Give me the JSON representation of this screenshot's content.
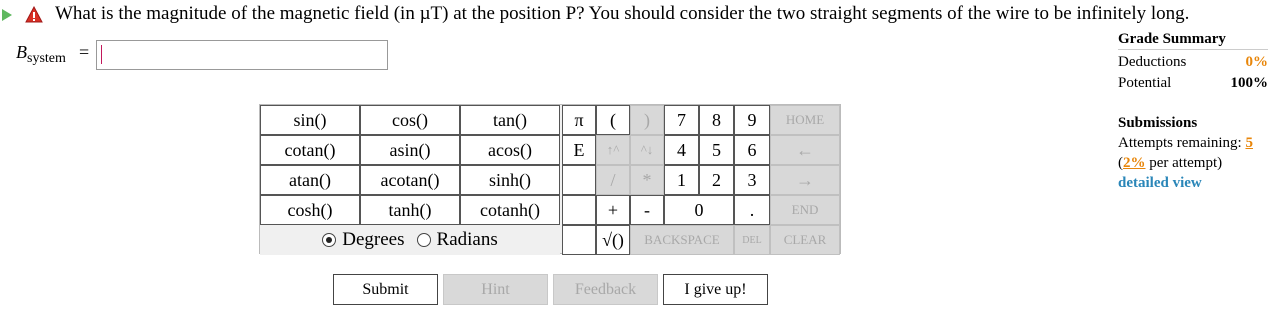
{
  "question": {
    "text": "What is the magnitude of the magnetic field (in µT) at the position P? You should consider the two straight segments of the wire to be infinitely long."
  },
  "answer": {
    "symbol": "B",
    "subscript": "system",
    "equals": "=",
    "value": ""
  },
  "grade_summary": {
    "title": "Grade Summary",
    "deductions_label": "Deductions",
    "deductions_value": "0%",
    "potential_label": "Potential",
    "potential_value": "100%"
  },
  "submissions": {
    "title": "Submissions",
    "attempts_label": "Attempts remaining:",
    "attempts_value": "5",
    "per_attempt_open": "(",
    "per_attempt_value": "2%",
    "per_attempt_text": " per attempt)",
    "detailed_view": "detailed view"
  },
  "keypad": {
    "functions": [
      "sin()",
      "cos()",
      "tan()",
      "cotan()",
      "asin()",
      "acos()",
      "atan()",
      "acotan()",
      "sinh()",
      "cosh()",
      "tanh()",
      "cotanh()"
    ],
    "symbols": {
      "pi": "π",
      "lparen": "(",
      "rparen": ")",
      "e": "E",
      "up_arrow": "↑^",
      "up_down": "^↓",
      "divide": "/",
      "multiply": "*",
      "plus": "+",
      "minus": "-",
      "sqrt": "√()"
    },
    "digits": [
      "7",
      "8",
      "9",
      "4",
      "5",
      "6",
      "1",
      "2",
      "3",
      "0",
      "."
    ],
    "nav": {
      "home": "HOME",
      "left": "←",
      "right": "→",
      "end": "END",
      "backspace": "BACKSPACE",
      "del": "DEL",
      "clear": "CLEAR"
    },
    "angle": {
      "degrees": "Degrees",
      "radians": "Radians",
      "selected": "Degrees"
    }
  },
  "buttons": {
    "submit": "Submit",
    "hint": "Hint",
    "feedback": "Feedback",
    "give_up": "I give up!"
  },
  "colors": {
    "accent_orange": "#e8860a",
    "link_blue": "#2a86b8",
    "play_green": "#5fb85f",
    "warning_red": "#d93025"
  }
}
